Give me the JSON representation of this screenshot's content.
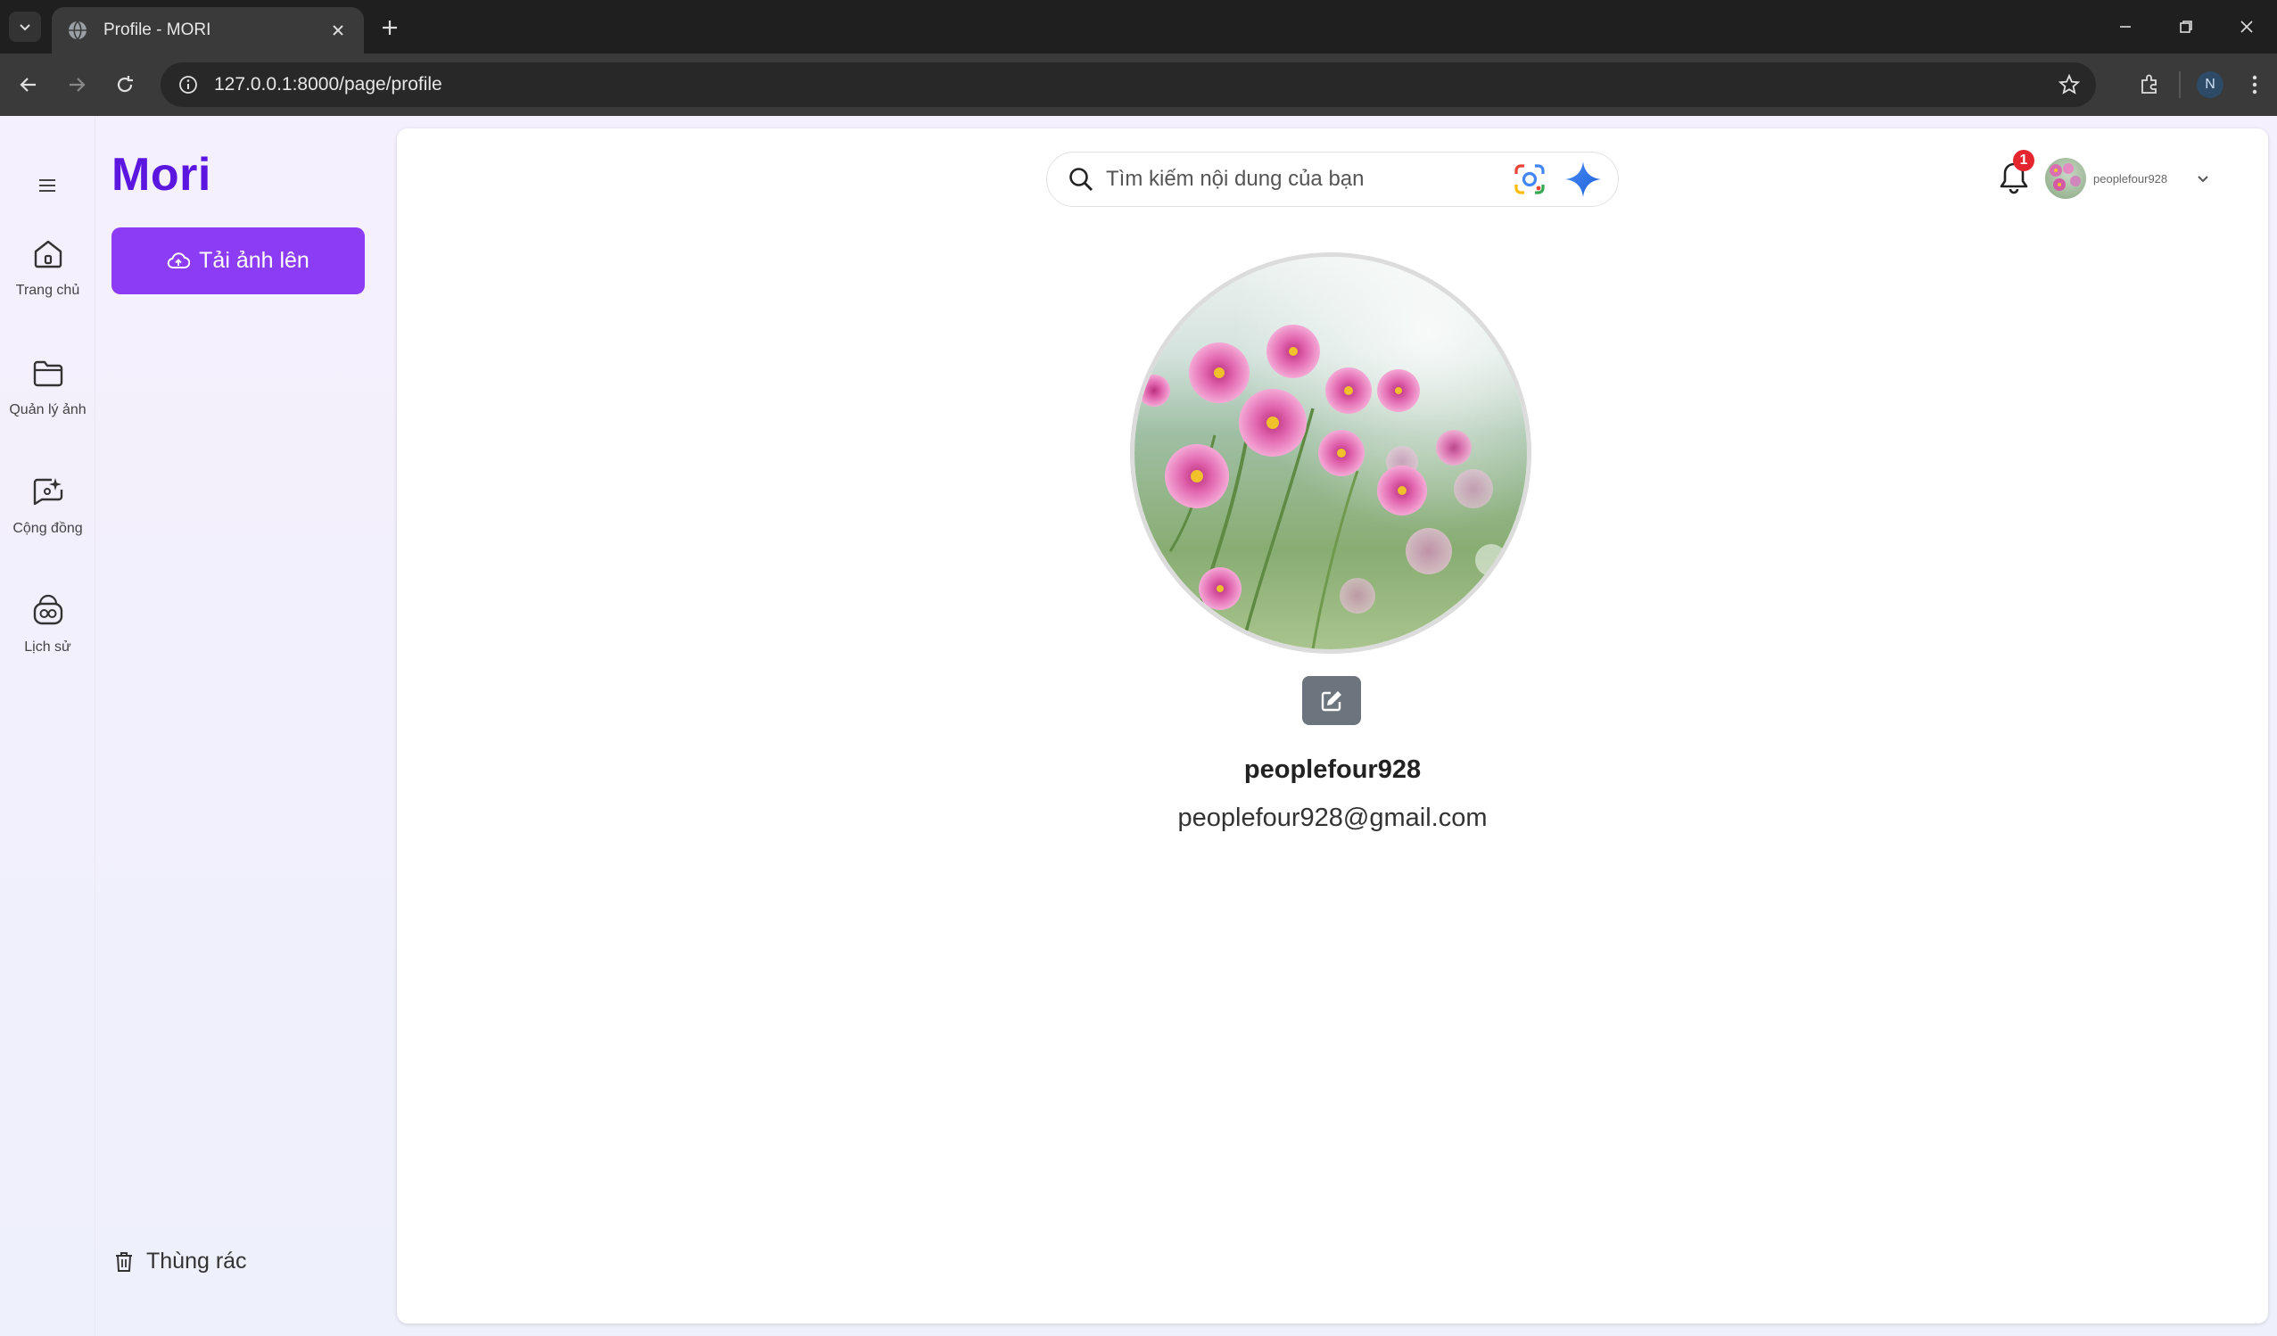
{
  "browser": {
    "tab_title": "Profile - MORI",
    "url": "127.0.0.1:8000/page/profile",
    "profile_initial": "N"
  },
  "sidebar": {
    "rail_items": [
      {
        "label": "Trang chủ",
        "icon": "home-icon"
      },
      {
        "label": "Quản lý ảnh",
        "icon": "folder-icon"
      },
      {
        "label": "Cộng đồng",
        "icon": "community-icon"
      },
      {
        "label": "Lịch sử",
        "icon": "history-icon"
      }
    ],
    "logo": "Mori",
    "upload_label": "Tải ảnh lên",
    "trash_label": "Thùng rác"
  },
  "header": {
    "search_placeholder": "Tìm kiếm nội dung của bạn",
    "notification_count": "1",
    "username": "peoplefour928"
  },
  "profile": {
    "username": "peoplefour928",
    "email": "peoplefour928@gmail.com"
  },
  "colors": {
    "brand": "#5b16e0",
    "upload_button": "#8c3cf5",
    "edit_button": "#6c757d",
    "badge": "#e6262f"
  }
}
